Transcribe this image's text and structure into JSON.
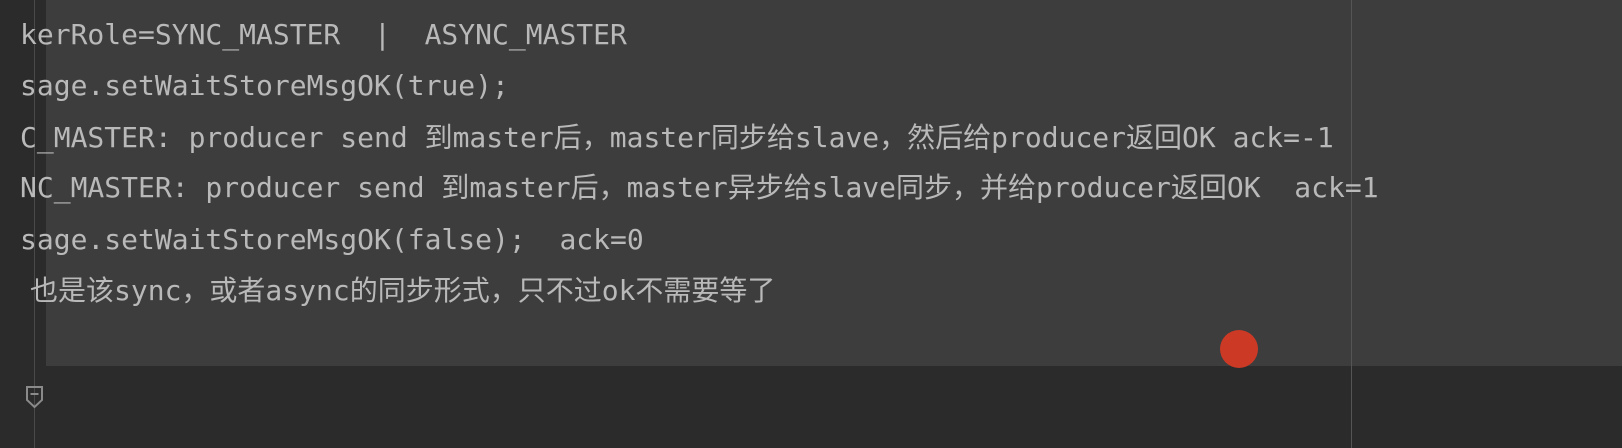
{
  "editor": {
    "lines": [
      "kerRole=SYNC_MASTER  |  ASYNC_MASTER",
      "sage.setWaitStoreMsgOK(true);",
      "C_MASTER: producer send 到master后，master同步给slave，然后给producer返回OK ack=-1",
      "NC_MASTER: producer send 到master后，master异步给slave同步，并给producer返回OK  ack=1",
      "sage.setWaitStoreMsgOK(false);  ack=0",
      "也是该sync，或者async的同步形式，只不过ok不需要等了"
    ]
  },
  "colors": {
    "background": "#2b2b2b",
    "doc_block": "#3d3d3d",
    "text": "#b9b9b9",
    "cursor_dot": "#cc3a26"
  },
  "icons": {
    "fold": "fold-marker-icon"
  }
}
